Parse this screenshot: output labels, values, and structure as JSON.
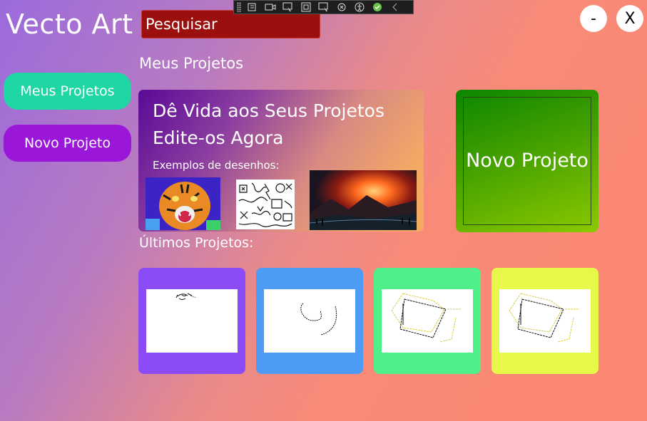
{
  "app": {
    "title": "Vecto Art"
  },
  "search": {
    "placeholder": "Pesquisar"
  },
  "window_controls": {
    "minimize": "-",
    "close": "X"
  },
  "sidebar": {
    "items": [
      {
        "label": "Meus Projetos",
        "color": "#1fd7a4"
      },
      {
        "label": "Novo Projeto",
        "color": "#9a16d8"
      }
    ]
  },
  "main": {
    "section_title": "Meus Projetos",
    "hero": {
      "line1": "Dê Vida aos Seus Projetos",
      "line2": "Edite-os Agora",
      "examples_label": "Exemplos de desenhos:",
      "examples": [
        "tiger-image",
        "doodle-image",
        "landscape-image"
      ]
    },
    "new_project_card": {
      "label": "Novo Projeto"
    },
    "recent_title": "Últimos Projetos:",
    "recent_projects": [
      {
        "color": "#8b4cf7"
      },
      {
        "color": "#4e9bf6"
      },
      {
        "color": "#4ff08a"
      },
      {
        "color": "#e8f84b"
      }
    ]
  },
  "debug_toolbar": {
    "icons": [
      "grip-icon",
      "live-tree-icon",
      "video-icon",
      "select-element-icon",
      "layout-adorner-icon",
      "track-focus-icon",
      "binding-icon",
      "accessibility-icon",
      "checkmark-icon",
      "collapse-icon"
    ]
  }
}
